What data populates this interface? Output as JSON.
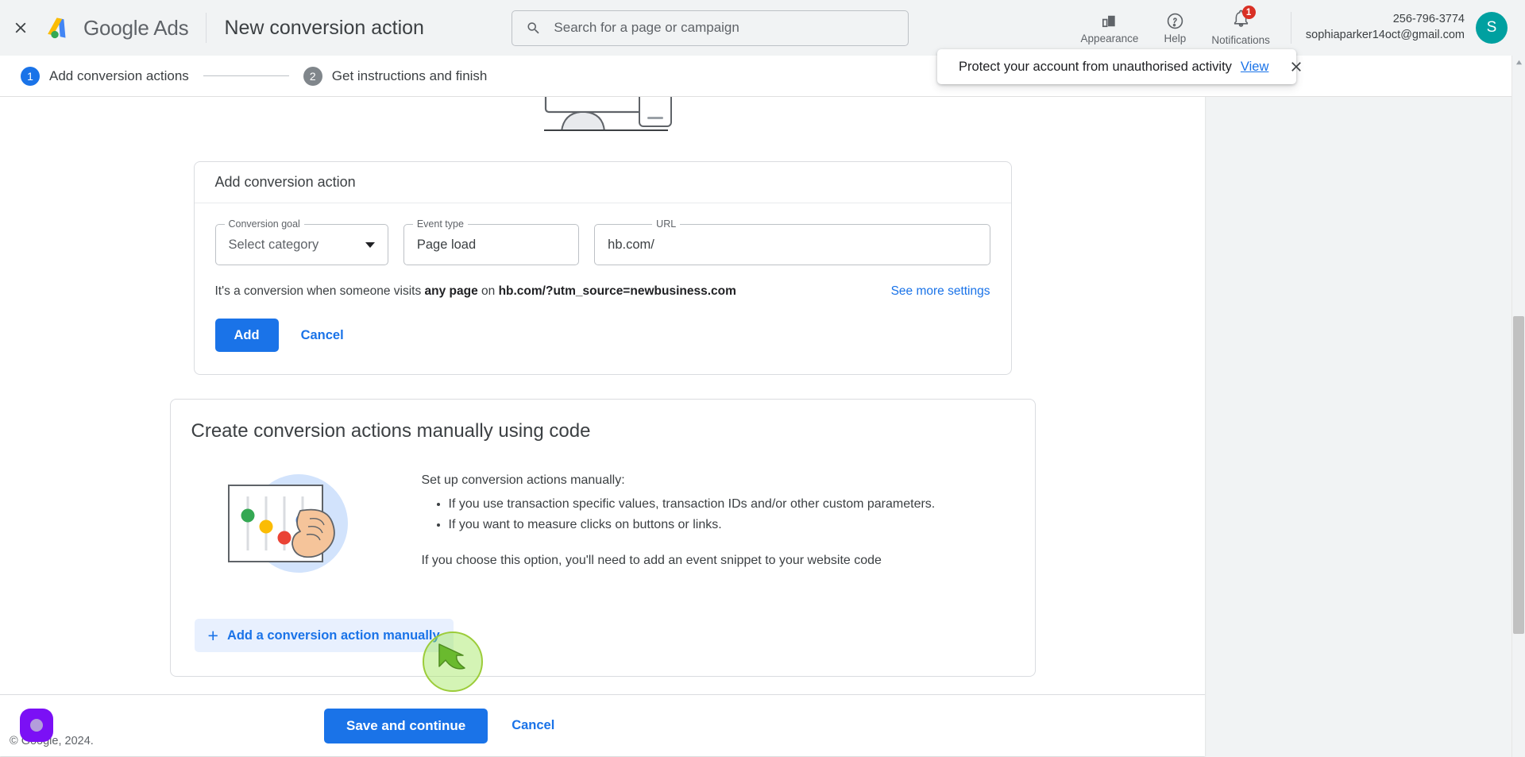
{
  "topbar": {
    "close_icon": "close-icon",
    "brand_google": "Google",
    "brand_ads": "Ads",
    "page_title": "New conversion action",
    "search_placeholder": "Search for a page or campaign",
    "search_value": "",
    "appearance_label": "Appearance",
    "help_label": "Help",
    "notifications_label": "Notifications",
    "notifications_badge": "1",
    "customer_id": "256-796-3774",
    "email": "sophiaparker14oct@gmail.com",
    "avatar_initial": "S"
  },
  "toast": {
    "message": "Protect your account from unauthorised activity",
    "view_label": "View",
    "icon": "error-circle-icon",
    "accent_color": "#d93025"
  },
  "stepper": {
    "steps": [
      {
        "num": "1",
        "label": "Add conversion actions",
        "state": "active"
      },
      {
        "num": "2",
        "label": "Get instructions and finish",
        "state": "inactive"
      }
    ]
  },
  "add_conversion_card": {
    "title": "Add conversion action",
    "fields": [
      {
        "label": "Conversion goal",
        "value": "Select category",
        "type": "select"
      },
      {
        "label": "Event type",
        "value": "Page load",
        "type": "text"
      },
      {
        "label": "URL",
        "value": "hb.com/",
        "type": "text"
      }
    ],
    "helper_prefix": "It's a conversion when someone visits ",
    "helper_bold": "any page",
    "helper_middle": " on ",
    "helper_url": "hb.com/?utm_source=newbusiness.com",
    "see_more_label": "See more settings",
    "add_label": "Add",
    "cancel_label": "Cancel"
  },
  "manual_card": {
    "title": "Create conversion actions manually using code",
    "intro": "Set up conversion actions manually:",
    "bullets": [
      "If you use transaction specific values, transaction IDs and/or other custom parameters.",
      "If you want to measure clicks on buttons or links."
    ],
    "note": "If you choose this option, you'll need to add an event snippet to your website code",
    "add_manual_label": "Add a conversion action manually"
  },
  "bottom_bar": {
    "save_label": "Save and continue",
    "cancel_label": "Cancel"
  },
  "footer": {
    "copyright": "© Google, 2024."
  },
  "colors": {
    "brand_blue": "#1a73e8",
    "error_red": "#d93025",
    "avatar_teal": "#00a0a0",
    "widget_purple": "#7b10f5",
    "cursor_green": "#9ccc3a"
  }
}
